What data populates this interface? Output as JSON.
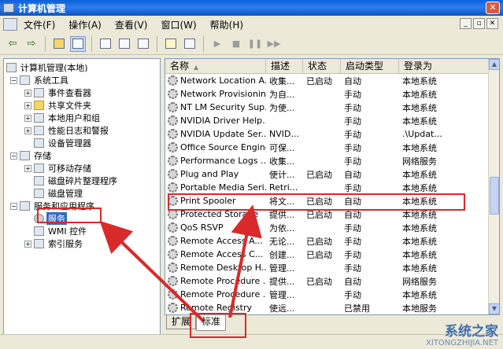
{
  "window": {
    "title": "计算机管理",
    "close_glyph": "✕"
  },
  "menu": {
    "items": [
      "文件(F)",
      "操作(A)",
      "查看(V)",
      "窗口(W)",
      "帮助(H)"
    ],
    "min_glyph": "_",
    "restore_glyph": "▫",
    "close_glyph": "✕"
  },
  "toolbar": {
    "back": "⇦",
    "forward": "⇨",
    "play": "▶",
    "stop": "■",
    "pause": "❚❚",
    "restart": "▶▶"
  },
  "tree": {
    "items": [
      {
        "label": "计算机管理(本地)"
      },
      {
        "label": "系统工具"
      },
      {
        "label": "事件查看器"
      },
      {
        "label": "共享文件夹"
      },
      {
        "label": "本地用户和组"
      },
      {
        "label": "性能日志和警报"
      },
      {
        "label": "设备管理器"
      },
      {
        "label": "存储"
      },
      {
        "label": "可移动存储"
      },
      {
        "label": "磁盘碎片整理程序"
      },
      {
        "label": "磁盘管理"
      },
      {
        "label": "服务和应用程序"
      },
      {
        "label": "服务"
      },
      {
        "label": "WMI 控件"
      },
      {
        "label": "索引服务"
      }
    ]
  },
  "list": {
    "headers": [
      "名称",
      "描述",
      "状态",
      "启动类型",
      "登录为"
    ],
    "sort_glyph": "▲",
    "rows": [
      [
        "Network Location A...",
        "收集...",
        "已启动",
        "自动",
        "本地系统"
      ],
      [
        "Network Provisionin...",
        "为自...",
        "",
        "手动",
        "本地系统"
      ],
      [
        "NT LM Security Sup...",
        "为使...",
        "",
        "手动",
        "本地系统"
      ],
      [
        "NVIDIA Driver Help...",
        "",
        "",
        "手动",
        "本地系统"
      ],
      [
        "NVIDIA Update Ser...",
        "NVID...",
        "",
        "手动",
        ".\\Updat..."
      ],
      [
        "Office Source Engine",
        "可保...",
        "",
        "手动",
        "本地系统"
      ],
      [
        "Performance Logs ...",
        "收集...",
        "",
        "手动",
        "网络服务"
      ],
      [
        "Plug and Play",
        "使计...",
        "已启动",
        "自动",
        "本地系统"
      ],
      [
        "Portable Media Seri...",
        "Retri...",
        "",
        "手动",
        "本地系统"
      ],
      [
        "Print Spooler",
        "将文...",
        "已启动",
        "自动",
        "本地系统"
      ],
      [
        "Protected Storage",
        "提供...",
        "已启动",
        "自动",
        "本地系统"
      ],
      [
        "QoS RSVP",
        "为依...",
        "",
        "手动",
        "本地系统"
      ],
      [
        "Remote Access A...",
        "无论...",
        "已启动",
        "手动",
        "本地系统"
      ],
      [
        "Remote Access C...",
        "创建...",
        "已启动",
        "手动",
        "本地系统"
      ],
      [
        "Remote Desktop H...",
        "管理...",
        "",
        "手动",
        "本地系统"
      ],
      [
        "Remote Procedure ...",
        "提供...",
        "已启动",
        "自动",
        "网络服务"
      ],
      [
        "Remote Procedure ...",
        "管理...",
        "",
        "手动",
        "本地系统"
      ],
      [
        "Remote Registry",
        "使远...",
        "",
        "已禁用",
        "本地服务"
      ]
    ]
  },
  "tabs": [
    "扩展",
    "标准"
  ],
  "watermark": {
    "title": "系统之家",
    "url": "XITONGZHIJIA.NET"
  },
  "colors": {
    "highlight": "#d82a2a",
    "selection": "#316ac5",
    "title_bar": "#0a5fd8"
  }
}
